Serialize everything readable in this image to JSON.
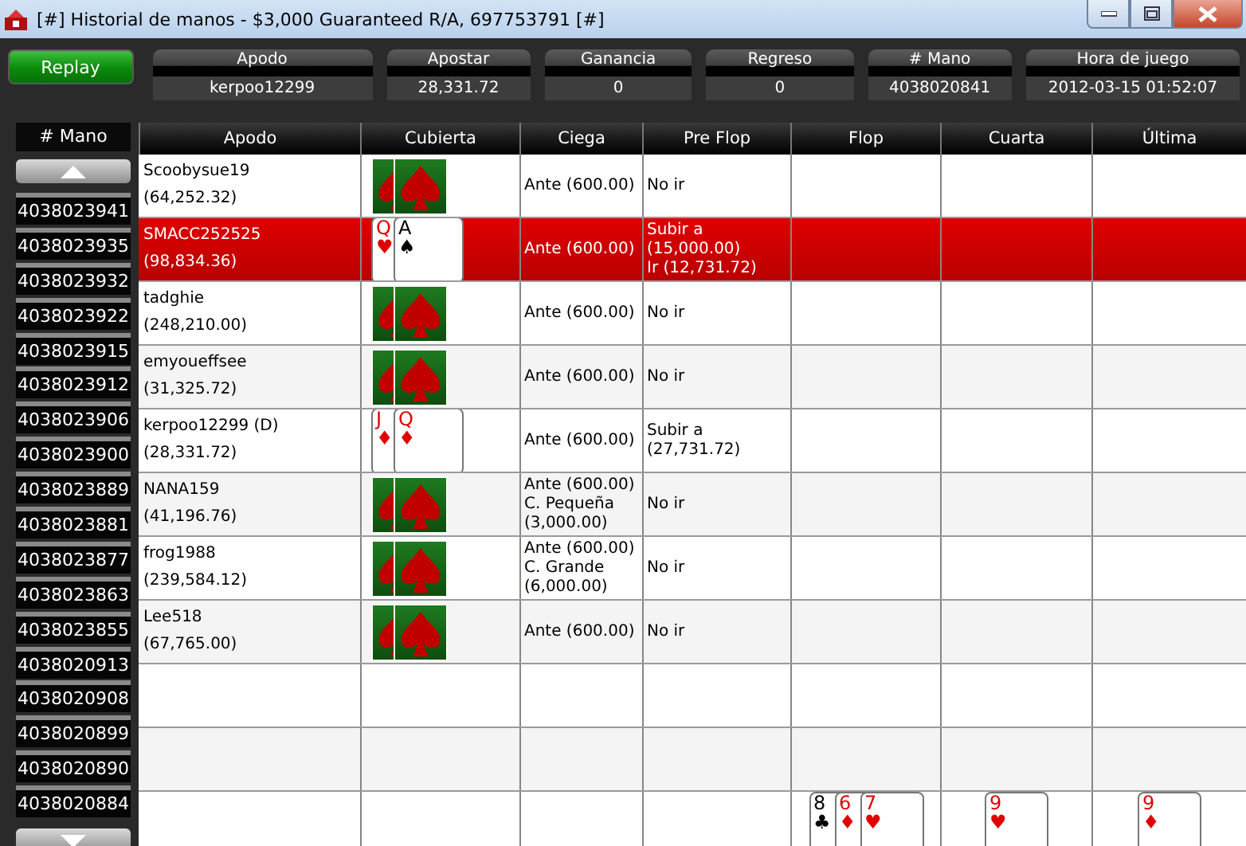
{
  "window": {
    "title": "[#] Historial de manos - $3,000 Guaranteed R/A, 697753791 [#]"
  },
  "replay_button": "Replay",
  "summary": [
    {
      "label": "Apodo",
      "value": "kerpoo12299"
    },
    {
      "label": "Apostar",
      "value": "28,331.72"
    },
    {
      "label": "Ganancia",
      "value": "0"
    },
    {
      "label": "Regreso",
      "value": "0"
    },
    {
      "label": "# Mano",
      "value": "4038020841"
    },
    {
      "label": "Hora de juego",
      "value": "2012-03-15 01:52:07"
    }
  ],
  "hands_list": {
    "header": "# Mano",
    "items": [
      {
        "label": "4038023941",
        "selected": false
      },
      {
        "label": "4038023935",
        "selected": false
      },
      {
        "label": "4038023932",
        "selected": false
      },
      {
        "label": "4038023922",
        "selected": false
      },
      {
        "label": "4038023915",
        "selected": false
      },
      {
        "label": "4038023912",
        "selected": false
      },
      {
        "label": "4038023906",
        "selected": false
      },
      {
        "label": "4038023900",
        "selected": false
      },
      {
        "label": "4038023889",
        "selected": false
      },
      {
        "label": "4038023881",
        "selected": false
      },
      {
        "label": "4038023877",
        "selected": false
      },
      {
        "label": "4038023863",
        "selected": false
      },
      {
        "label": "4038023855",
        "selected": false
      },
      {
        "label": "4038020913",
        "selected": false
      },
      {
        "label": "4038020908",
        "selected": false
      },
      {
        "label": "4038020899",
        "selected": false
      },
      {
        "label": "4038020890",
        "selected": false
      },
      {
        "label": "4038020884",
        "selected": false
      }
    ]
  },
  "table": {
    "columns": [
      "Apodo",
      "Cubierta",
      "Ciega",
      "Pre Flop",
      "Flop",
      "Cuarta",
      "Última"
    ],
    "rows": [
      {
        "name": "Scoobysue19",
        "stack": "(64,252.32)",
        "selected": false,
        "cards": [
          {
            "kind": "back"
          },
          {
            "kind": "back"
          }
        ],
        "blind": [
          "Ante (600.00)"
        ],
        "preflop": [
          "No ir"
        ]
      },
      {
        "name": "SMACC252525",
        "stack": "(98,834.36)",
        "selected": true,
        "cards": [
          {
            "kind": "face",
            "rank": "Q",
            "suit": "♥",
            "color": "#e00000"
          },
          {
            "kind": "face",
            "rank": "A",
            "suit": "♠",
            "color": "#000000"
          }
        ],
        "blind": [
          "Ante (600.00)"
        ],
        "preflop": [
          "Subir a",
          "(15,000.00)",
          "Ir (12,731.72)"
        ]
      },
      {
        "name": "tadghie",
        "stack": "(248,210.00)",
        "selected": false,
        "cards": [
          {
            "kind": "back"
          },
          {
            "kind": "back"
          }
        ],
        "blind": [
          "Ante (600.00)"
        ],
        "preflop": [
          "No ir"
        ]
      },
      {
        "name": "emyoueffsee",
        "stack": "(31,325.72)",
        "selected": false,
        "cards": [
          {
            "kind": "back"
          },
          {
            "kind": "back"
          }
        ],
        "blind": [
          "Ante (600.00)"
        ],
        "preflop": [
          "No ir"
        ]
      },
      {
        "name": "kerpoo12299 (D)",
        "stack": "(28,331.72)",
        "selected": false,
        "cards": [
          {
            "kind": "face",
            "rank": "J",
            "suit": "♦",
            "color": "#e00000"
          },
          {
            "kind": "face",
            "rank": "Q",
            "suit": "♦",
            "color": "#e00000"
          }
        ],
        "blind": [
          "Ante (600.00)"
        ],
        "preflop": [
          "Subir a",
          "(27,731.72)"
        ]
      },
      {
        "name": "NANA159",
        "stack": "(41,196.76)",
        "selected": false,
        "cards": [
          {
            "kind": "back"
          },
          {
            "kind": "back"
          }
        ],
        "blind": [
          "Ante (600.00)",
          "C. Pequeña",
          "(3,000.00)"
        ],
        "preflop": [
          "No ir"
        ]
      },
      {
        "name": "frog1988",
        "stack": "(239,584.12)",
        "selected": false,
        "cards": [
          {
            "kind": "back"
          },
          {
            "kind": "back"
          }
        ],
        "blind": [
          "Ante (600.00)",
          "C. Grande",
          "(6,000.00)"
        ],
        "preflop": [
          "No ir"
        ]
      },
      {
        "name": "Lee518",
        "stack": "(67,765.00)",
        "selected": false,
        "cards": [
          {
            "kind": "back"
          },
          {
            "kind": "back"
          }
        ],
        "blind": [
          "Ante (600.00)"
        ],
        "preflop": [
          "No ir"
        ]
      }
    ],
    "board": {
      "flop": [
        {
          "kind": "face",
          "rank": "8",
          "suit": "♣",
          "color": "#000000"
        },
        {
          "kind": "face",
          "rank": "6",
          "suit": "♦",
          "color": "#e00000"
        },
        {
          "kind": "face",
          "rank": "7",
          "suit": "♥",
          "color": "#e00000"
        }
      ],
      "turn": [
        {
          "kind": "face",
          "rank": "9",
          "suit": "♥",
          "color": "#e00000"
        }
      ],
      "river": [
        {
          "kind": "face",
          "rank": "9",
          "suit": "♦",
          "color": "#e00000"
        }
      ]
    }
  }
}
